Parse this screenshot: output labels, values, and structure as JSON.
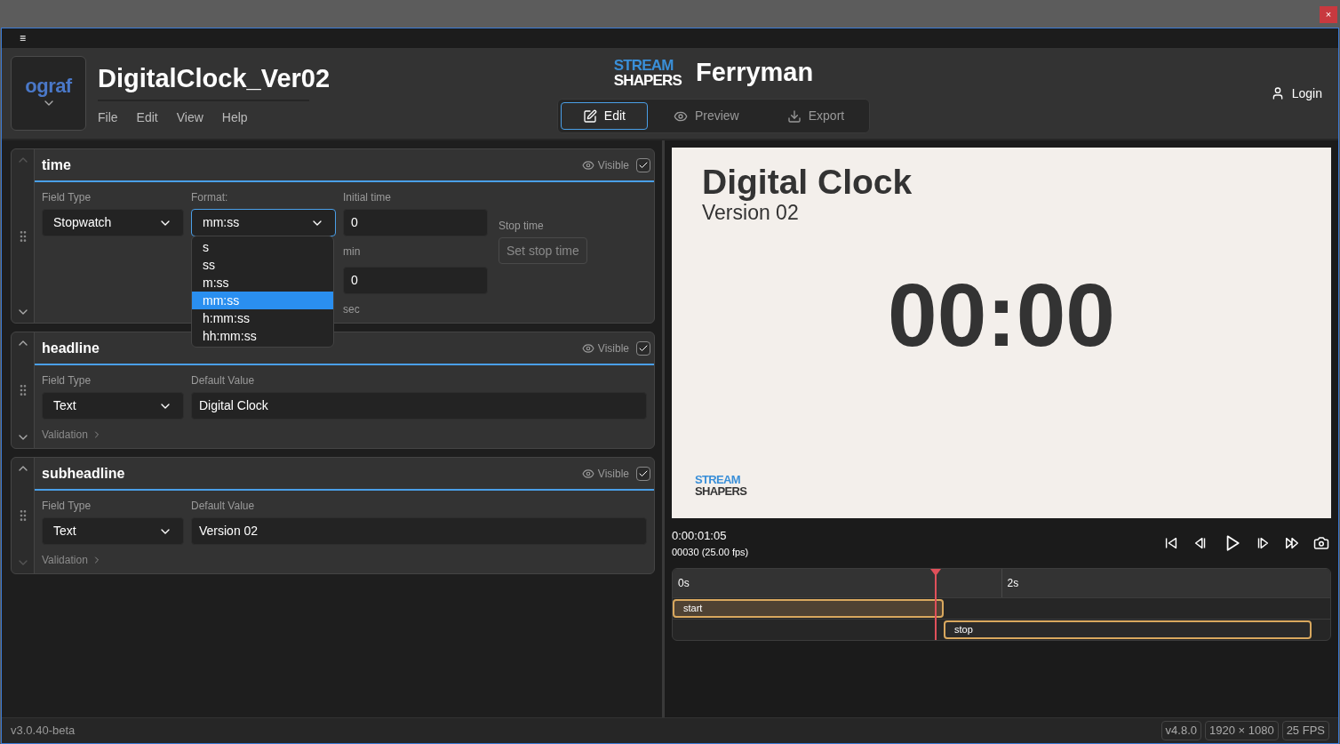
{
  "window": {
    "close": "×"
  },
  "menu_toggle": "≡",
  "header": {
    "logo": "ograf",
    "title": "DigitalClock_Ver02",
    "menu": [
      "File",
      "Edit",
      "View",
      "Help"
    ],
    "brand": {
      "logo_lines": [
        "STREAM",
        "SHAPERS"
      ],
      "name": "Ferryman"
    },
    "modes": [
      {
        "label": "Edit",
        "kind": "edit",
        "selected": true
      },
      {
        "label": "Preview",
        "kind": "preview",
        "selected": false
      },
      {
        "label": "Export",
        "kind": "export",
        "selected": false
      }
    ],
    "login": "Login"
  },
  "fields": [
    {
      "name": "time",
      "kind": "stopwatch",
      "can_move_up": false,
      "can_move_down": true,
      "visible_label": "Visible",
      "visible": true,
      "field_type_label": "Field Type",
      "field_type": "Stopwatch",
      "format_label": "Format:",
      "format": "mm:ss",
      "format_expanded": true,
      "format_options": [
        {
          "label": "s",
          "selected": false
        },
        {
          "label": "ss",
          "selected": false
        },
        {
          "label": "m:ss",
          "selected": false
        },
        {
          "label": "mm:ss",
          "selected": true
        },
        {
          "label": "h:mm:ss",
          "selected": false
        },
        {
          "label": "hh:mm:ss",
          "selected": false
        }
      ],
      "initial_label": "Initial time",
      "minutes": "0",
      "minutes_unit": "min",
      "seconds": "0",
      "seconds_unit": "sec",
      "stop_label": "Stop time",
      "stop_button": "Set stop time"
    },
    {
      "name": "headline",
      "kind": "text",
      "can_move_up": true,
      "can_move_down": true,
      "visible_label": "Visible",
      "visible": true,
      "field_type_label": "Field Type",
      "field_type": "Text",
      "default_label": "Default Value",
      "value": "Digital Clock",
      "validation": "Validation"
    },
    {
      "name": "subheadline",
      "kind": "text",
      "can_move_up": true,
      "can_move_down": false,
      "visible_label": "Visible",
      "visible": true,
      "field_type_label": "Field Type",
      "field_type": "Text",
      "default_label": "Default Value",
      "value": "Version 02",
      "validation": "Validation"
    }
  ],
  "preview": {
    "headline": "Digital Clock",
    "subheadline": "Version 02",
    "clock": "00:00",
    "logo_lines": [
      "STREAM",
      "SHAPERS"
    ]
  },
  "player": {
    "timecode": "0:00:01:05",
    "frame": "00030 (25.00 fps)"
  },
  "timeline": {
    "ticks": [
      "0s",
      "2s"
    ],
    "tracks": [
      {
        "label": "start",
        "selected": true
      },
      {
        "label": "stop",
        "selected": false
      }
    ]
  },
  "status_bar": {
    "version": "v3.0.40-beta",
    "badges": [
      "v4.8.0",
      "1920 × 1080",
      "25 FPS"
    ]
  }
}
